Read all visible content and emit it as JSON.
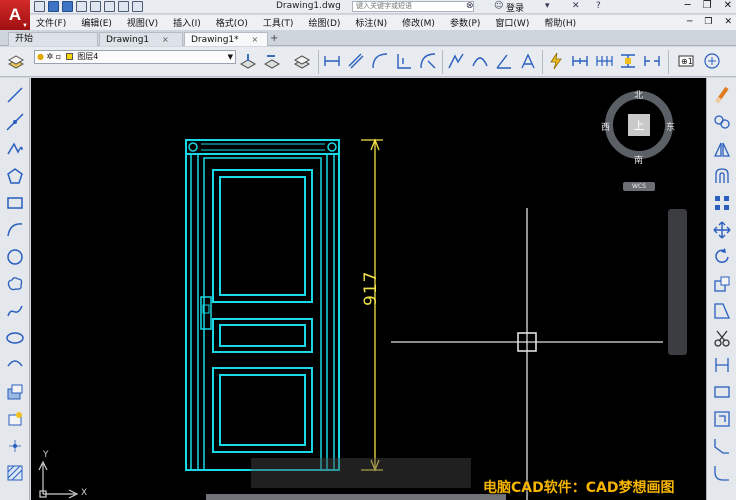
{
  "app": {
    "logo_letter": "A",
    "document_title": "Drawing1.dwg"
  },
  "search": {
    "placeholder": "键入关键字或短语"
  },
  "account": {
    "login_label": "登录"
  },
  "menu": {
    "items": [
      "文件(F)",
      "编辑(E)",
      "视图(V)",
      "插入(I)",
      "格式(O)",
      "工具(T)",
      "绘图(D)",
      "标注(N)",
      "修改(M)",
      "参数(P)",
      "窗口(W)",
      "帮助(H)"
    ]
  },
  "tabs": {
    "items": [
      {
        "label": "开始",
        "closable": false,
        "active": false
      },
      {
        "label": "Drawing1",
        "closable": true,
        "active": false
      },
      {
        "label": "Drawing1*",
        "closable": true,
        "active": true
      }
    ],
    "close_glyph": "×",
    "add_glyph": "+"
  },
  "layer": {
    "current": "图层4",
    "swatch_color": "#f2d400"
  },
  "viewcube": {
    "north": "北",
    "south": "南",
    "east": "东",
    "west": "西",
    "top_face": "上",
    "wcs_label": "WCS"
  },
  "drawing": {
    "dimension_value": "917",
    "door_color": "#19d9e6",
    "dimension_color": "#f2e24a",
    "crosshair_color": "#e0e0e0"
  },
  "ucs": {
    "y_label": "Y",
    "x_label": "X"
  },
  "watermark": {
    "text": "电脑CAD软件：CAD梦想画图"
  },
  "icons": {
    "title_right": [
      "binoculars-icon",
      "cart-icon",
      "help-icon"
    ],
    "window_controls": [
      "minimize-icon",
      "restore-icon",
      "close-icon"
    ]
  }
}
